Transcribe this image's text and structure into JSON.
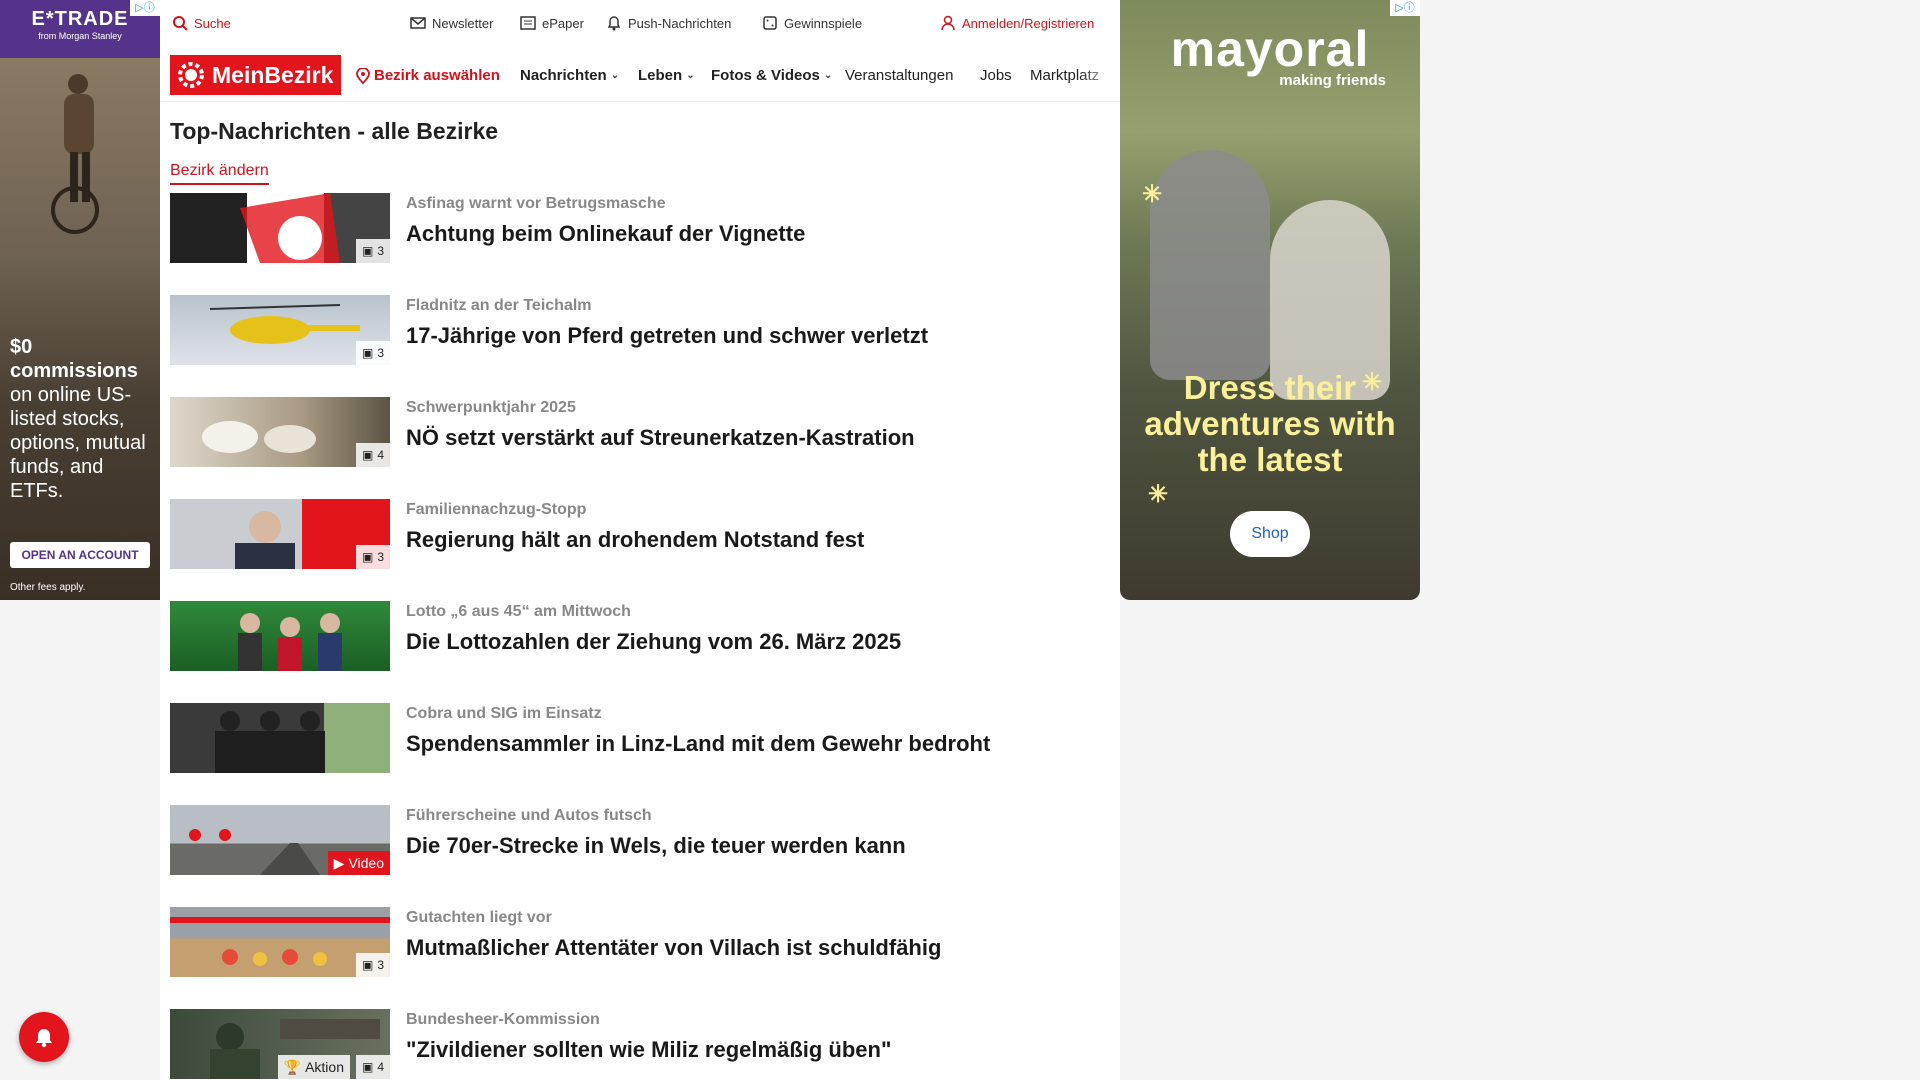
{
  "ads": {
    "left": {
      "brand": "E*TRADE",
      "brand_sub": "from Morgan Stanley",
      "headline_bold": "$0 commissions",
      "headline_rest": "on online US-listed stocks, options, mutual funds, and ETFs.",
      "cta": "OPEN AN ACCOUNT",
      "fine_print": "Other fees apply."
    },
    "right": {
      "logo": "mayoral",
      "tagline": "making friends",
      "headline": "Dress their adventures with the latest",
      "cta": "Shop"
    }
  },
  "util": {
    "search": "Suche",
    "newsletter": "Newsletter",
    "epaper": "ePaper",
    "push": "Push-Nachrichten",
    "gewinnspiele": "Gewinnspiele",
    "login": "Anmelden/Registrieren"
  },
  "nav": {
    "logo": "MeinBezirk",
    "select_district": "Bezirk auswählen",
    "items": [
      "Nachrichten",
      "Leben",
      "Fotos & Videos",
      "Veranstaltungen",
      "Jobs",
      "Marktplatz"
    ]
  },
  "page": {
    "title": "Top-Nachrichten - alle Bezirke",
    "change_district": "Bezirk ändern"
  },
  "articles": [
    {
      "kicker": "Asfinag warnt vor Betrugsmasche",
      "title": "Achtung beim Onlinekauf der Vignette",
      "badge": "3"
    },
    {
      "kicker": "Fladnitz an der Teichalm",
      "title": "17-Jährige von Pferd getreten und schwer verletzt",
      "badge": "3"
    },
    {
      "kicker": "Schwerpunktjahr 2025",
      "title": "NÖ setzt verstärkt auf Streunerkatzen-Kastration",
      "badge": "4"
    },
    {
      "kicker": "Familiennachzug-Stopp",
      "title": "Regierung hält an drohendem Notstand fest",
      "badge": "3"
    },
    {
      "kicker": "Lotto „6 aus 45“ am Mittwoch",
      "title": "Die Lottozahlen der Ziehung vom 26. März 2025",
      "badge": ""
    },
    {
      "kicker": "Cobra und SIG im Einsatz",
      "title": "Spendensammler in Linz-Land mit dem Gewehr bedroht",
      "badge": ""
    },
    {
      "kicker": "Führerscheine und Autos futsch",
      "title": "Die 70er-Strecke in Wels, die teuer werden kann",
      "badge": "Video"
    },
    {
      "kicker": "Gutachten liegt vor",
      "title": "Mutmaßlicher Attentäter von Villach ist schuldfähig",
      "badge": "3"
    },
    {
      "kicker": "Bundesheer-Kommission",
      "title": "\"Zivildiener sollten wie Miliz regelmäßig üben\"",
      "badge": "4",
      "badge2": "Aktion"
    }
  ]
}
